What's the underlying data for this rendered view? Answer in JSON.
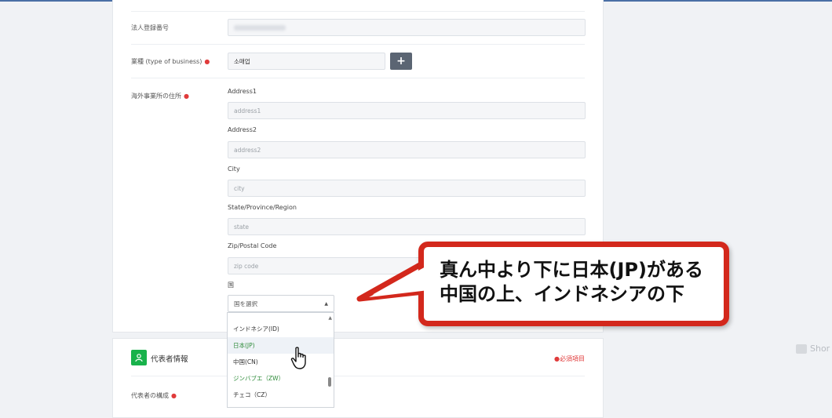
{
  "business_info": {
    "corp_reg_label": "法人登録番号",
    "corp_reg_value": "",
    "business_type_label": "業種 (type of business)",
    "business_type_value": "소매업",
    "add_label": "+",
    "overseas_address_label": "海外事業所の住所",
    "required_dot": "●",
    "address1_label": "Address1",
    "address1_placeholder": "address1",
    "address2_label": "Address2",
    "address2_placeholder": "address2",
    "city_label": "City",
    "city_placeholder": "city",
    "state_label": "State/Province/Region",
    "state_placeholder": "state",
    "zip_label": "Zip/Postal Code",
    "zip_placeholder": "zip code",
    "country_label": "国",
    "country_select": "国を選択",
    "country_options": [
      "インドネシア(ID)",
      "日本(JP)",
      "中国(CN)",
      "ジンバブエ（ZW）",
      "チェコ（CZ）"
    ]
  },
  "representative": {
    "section_title": "代表者情報",
    "required_note": "●必須項目",
    "structure_label": "代表者の構成"
  },
  "callout": {
    "line1": "真ん中より下に日本(JP)がある",
    "line2": "中国の上、インドネシアの下"
  },
  "watermark": "Shor",
  "colors": {
    "required": "#e03b3b",
    "accent_green": "#18b24b",
    "callout_border": "#d3281c",
    "button": "#5b6573"
  },
  "icons": [
    "person-icon",
    "plus-icon",
    "caret-up-icon",
    "hand-cursor-icon"
  ]
}
